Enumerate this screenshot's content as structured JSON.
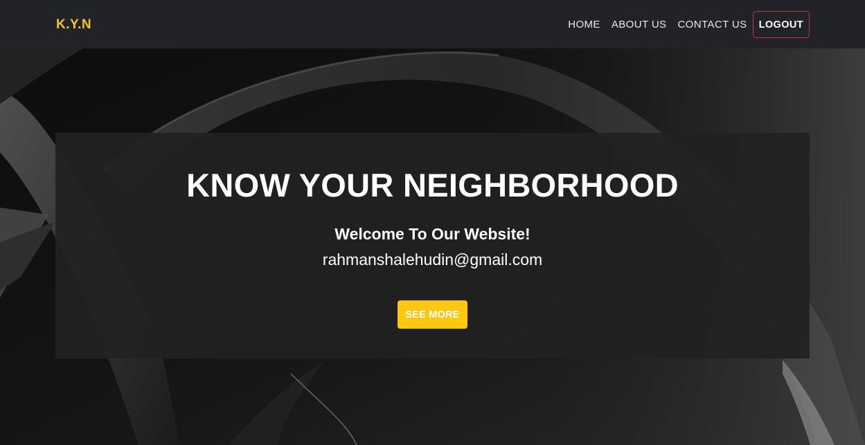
{
  "nav": {
    "brand": "K.Y.N",
    "links": [
      "HOME",
      "ABOUT US",
      "CONTACT US"
    ],
    "logout": "LOGOUT"
  },
  "hero": {
    "title": "KNOW YOUR NEIGHBORHOOD",
    "welcome": "Welcome To Our Website!",
    "email": "rahmanshalehudin@gmail.com",
    "cta": "SEE MORE"
  },
  "colors": {
    "brand": "#f8c512",
    "cta": "#fec810",
    "logout_border": "#c9353e",
    "navbar": "#212328"
  }
}
